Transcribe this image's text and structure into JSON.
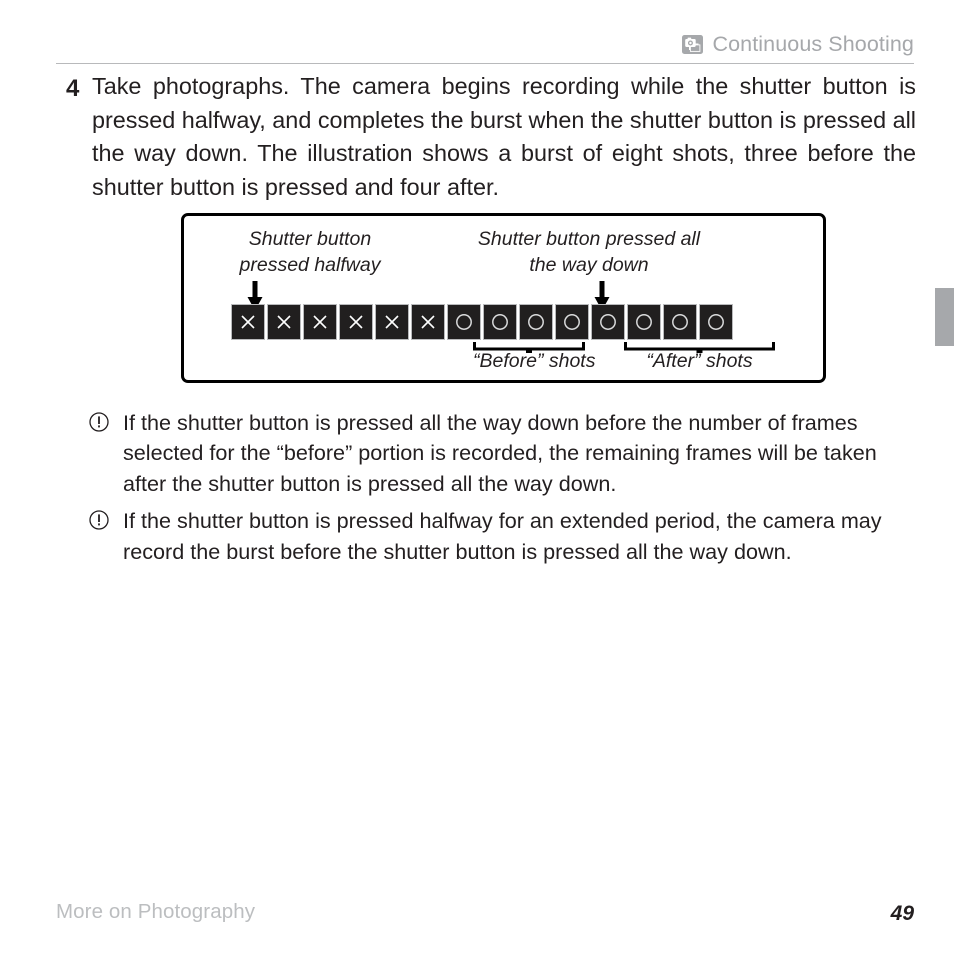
{
  "header": {
    "icon": "continuous-shooting-icon",
    "title": "Continuous Shooting"
  },
  "step": {
    "number": "4",
    "text": "Take photographs. The camera begins recording while the shutter button is pressed halfway, and completes the burst when the shutter button is pressed all the way down. The illustration shows a burst of eight shots, three before the shutter button is pressed and four after."
  },
  "figure": {
    "label_halfway": "Shutter button\npressed halfway",
    "label_full_down": "Shutter button pressed all\nthe way down",
    "bracket_before_label": "“Before” shots",
    "bracket_after_label": "“After” shots",
    "frames": [
      {
        "mark": "x"
      },
      {
        "mark": "x"
      },
      {
        "mark": "x"
      },
      {
        "mark": "x"
      },
      {
        "mark": "x"
      },
      {
        "mark": "x"
      },
      {
        "mark": "o"
      },
      {
        "mark": "o"
      },
      {
        "mark": "o"
      },
      {
        "mark": "o"
      },
      {
        "mark": "o"
      },
      {
        "mark": "o"
      },
      {
        "mark": "o"
      },
      {
        "mark": "o"
      }
    ],
    "frame_count_total": 14,
    "frame_count_x": 6,
    "frame_count_before": 3,
    "frame_count_after": 4,
    "colors": {
      "frame_fill": "#211f1f",
      "frame_border": "#b9babc",
      "mark": "#ffffff",
      "box_border": "#000000"
    }
  },
  "notes": [
    {
      "marker": "caution-icon",
      "text": "If the shutter button is pressed all the way down before the number of frames selected for the “before” portion is recorded, the remaining frames will be taken after the shutter button is pressed all the way down."
    },
    {
      "marker": "caution-icon",
      "text": "If the shutter button is pressed halfway for an extended period, the camera may record the burst before the shutter button is pressed all the way down."
    }
  ],
  "footer": {
    "section": "More on Photography",
    "page_number": "49"
  },
  "edge_tab": {
    "color": "#a6a8ab"
  }
}
